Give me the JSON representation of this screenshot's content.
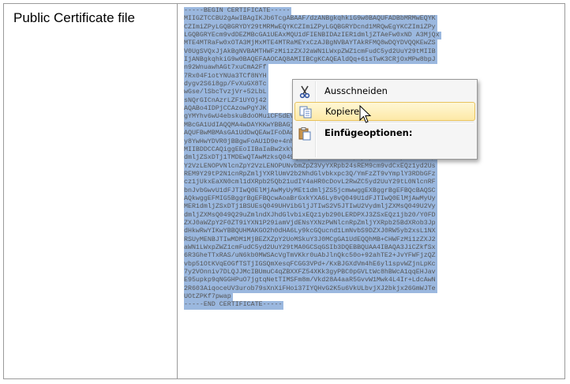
{
  "label": "Public Certificate file",
  "certificate_lines": [
    "-----BEGIN CERTIFICATE-----",
    "MIIGZTCCBU2gAwIBAgIKJb6TcgABAAF/dzANBgkqhkiG9w0BAQUFADBbMRMwEQYK",
    "CZImiZPyLGQBGRYDY29tMRMwEQYKCZImiZPyLGQBGRYDcnd1MRQwEgYKCZImiZPy",
    "LGQBGRYEcm9vdDEZMBcGA1UEAxMQU1dFIENBIDAzIER1dmljZTAeFw0xND A3MjQx",
    "MTE4MTRaFw0xOTA3MjMxMTE4MTRaMEYxCzAJBgNVBAYTAkRFMQ8wDQYDVQQKEwZS",
    "V0UgSVQxJjAkBgNVBAMTHWFzMi1zZXJ2aWN1LWxpZWZ1cmFudC5yd2UuY29tMIIB",
    "IjANBgkqhkiG9w0BAQEFAAOCAQ8AMIIBCgKCAQEAldQq+61sTwK3CRjOxMPw8bpJ",
    "n92WnuawhAGt7xuCmA2Ff",
    "7Rx04F1otYNUa3TCf8NYH",
    "dygv2S6i8gp/FvXuGX8Tc",
    "wGse/lSbcTvzjVr+52LbL",
    "sNQrGICnAzrLZF1UYOj42",
    "AQABo4IDPjCCAzowPgYJK",
    "gYMYhv6wU4ebskuBdoOMuiCF5dEVAgFkAgEGMBMGA1UdJQQMMAoGCCsGAQUFBwMB",
    "MBcGA1UdIAQQMA4wDAYKKwYBBAGjAmQBATAbBgkrBgEEAYI3FQoEDjAMMAoGCCsG",
    "AQUFBwMBMAsGA1UdDwQEAwIFoDAdBgNVHQ4EFgQU7AeO9WoKF02UUPu5j7uxtEb6",
    "y8YwHwYDVR0jBBgwFoAU1D9e+4nhrIRmFvfP4FHL1g48YYwggEZBgNVHR8EggEQ",
    "MIIBDDCCAQiggEEoIIBaIaBw2xkYXA6Ly8vQ049U1dFJTIwQ0ElMjAwMyUyMEt1",
    "dmljZSxDTj1TMDEwQTAwMzksQ049Q0RQLENOPVB1YmxpYyUyMEtleSUyMFNlcnZp",
    "Y2VzLENOPVNlcnZpY2VzLENOPUNvbmZpZ3VyYXRpb24sREM9cm9vdCxEQz1yd2Us",
    "REM9Y29tP2N1cnRpZmljYXRlUmV2b2NhdGlvbkxpc3Q/YmFzZT9vYmplY3RDbGFz",
    "cz1jUkxEaXN0cml1dXRpb25Qb21udIY4aHR0cDovL2RwZC5yd2UuY29tL0NlcnRF",
    "bnJvbGwvU1dFJTIwQ0ElMjAwMyUyMEt1dmljZS5jcmwwggEXBggrBgEFBQcBAQSC",
    "AQkwggEFMIG5BggrBgEFBQcwAoaBrGxkYXA6Ly8vQ049U1dFJTIwQ0ElMjAwMyUy",
    "MER1dmljZSxDTj1BSUEsQ049UHVibGljJTIwS2V5JTIwU2VydmljZXMsQ049U2Vy",
    "dmljZXMsQ049Q29uZmlndXJhdGlvbixEQz1yb290LERDPXJ3ZSxEQz1jb20/Y0FD",
    "ZXJ0aWZpY2F0ZT9iYXN1P29iamVjdENsYXNzPWNlcnRpZmljYXRpb25BdXRob3Jp",
    "dHkwRwYIKwYBBQUHMAKGO2h0dHA6Ly9kcGQucnd1LmNvbS9DZXJ0RW5yb2xsL1NX",
    "RSUyMENBJTIwMDM1MjBEZXZpY2UoMSkuY3J0MCgGA1UdEQQhMB+CHWFzMi1zZXJ2",
    "aWN1LWxpZWZ1cmFudC5yd2UuY29tMA0GCSqGSIb3DQEBBQUAA4IBAQA3JiCZkfSx",
    "6R3GheTTxRAS/uN6kb0MWSAcVgTmVKkr0uAbJlnQkc50o+92ahTE2+JvYFWFjzQZ",
    "vbp51OtKVqEOGfTSTjIGSQmXesqFCGG3VPd+/KxBJGXdVm4hE6yl1spvWZjnLpKc",
    "7y2VOnniv7DLQJJMcIBUmuC4qZBXXFZ54XKk3gyPBC0pGVLtWc8hBWcA1qqEHJav",
    "E95upkp9qNGGHPuO7jgtqNetTIMSFm8m/Vkd28A4aaR5GvvW1Mwk4L4Ir+LdcAwN",
    "2R603AiqoceUV3urob79sXnXiFHoi37IYQHvG2K5u6VkULbvjXJ2bkjx26GmWJTe",
    "UOtZPKf7pwap",
    "-----END CERTIFICATE-----"
  ],
  "context_menu": {
    "items": [
      {
        "label": "Ausschneiden",
        "icon": "scissors-icon"
      },
      {
        "label": "Kopieren",
        "icon": "copy-icon"
      },
      {
        "label": "Einfügeoptionen:",
        "icon": "paste-icon"
      }
    ]
  },
  "colors": {
    "selection": "#9bb8df",
    "highlight_border": "#e8c35e",
    "highlight_fill": "#fde9a6"
  }
}
